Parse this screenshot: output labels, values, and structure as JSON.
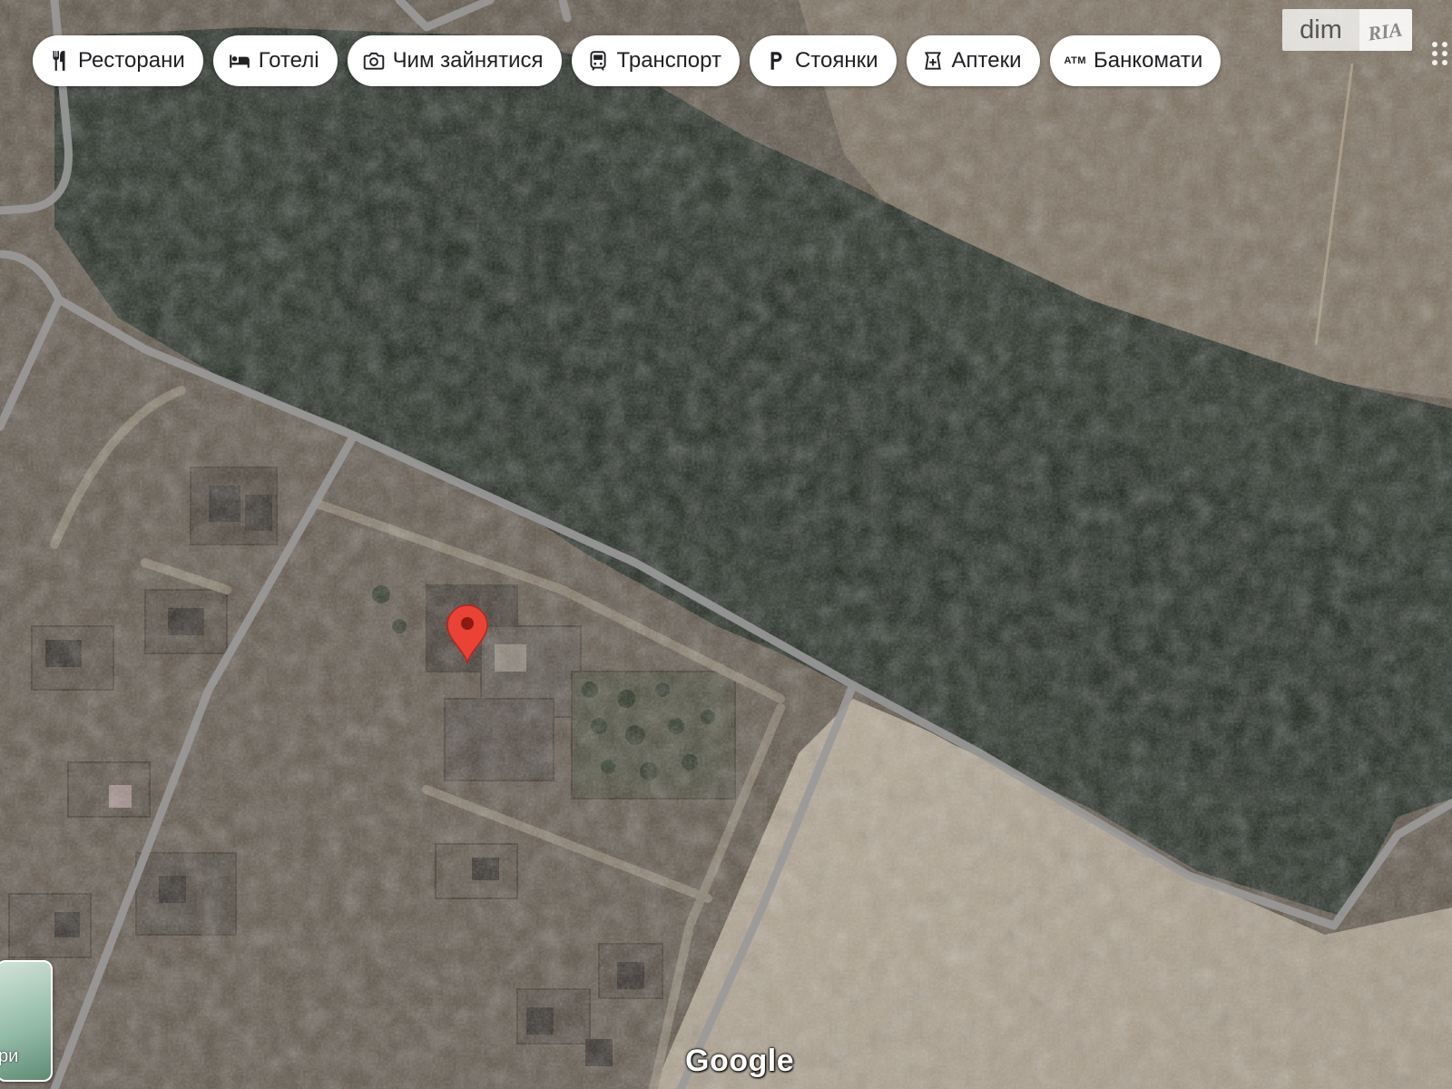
{
  "map": {
    "type": "satellite",
    "attribution": "Google",
    "marker_color": "#ea4335"
  },
  "categories": [
    {
      "label": "Ресторани",
      "icon": "restaurant-icon"
    },
    {
      "label": "Готелі",
      "icon": "hotel-bed-icon"
    },
    {
      "label": "Чим зайнятися",
      "icon": "camera-icon"
    },
    {
      "label": "Транспорт",
      "icon": "transit-bus-icon"
    },
    {
      "label": "Стоянки",
      "icon": "parking-icon"
    },
    {
      "label": "Аптеки",
      "icon": "pharmacy-icon"
    },
    {
      "label": "Банкомати",
      "icon": "atm-icon",
      "icon_text": "ATM"
    }
  ],
  "watermark": {
    "left": "dim",
    "right": "RIA"
  },
  "layers": {
    "label_fragment": "ри"
  }
}
